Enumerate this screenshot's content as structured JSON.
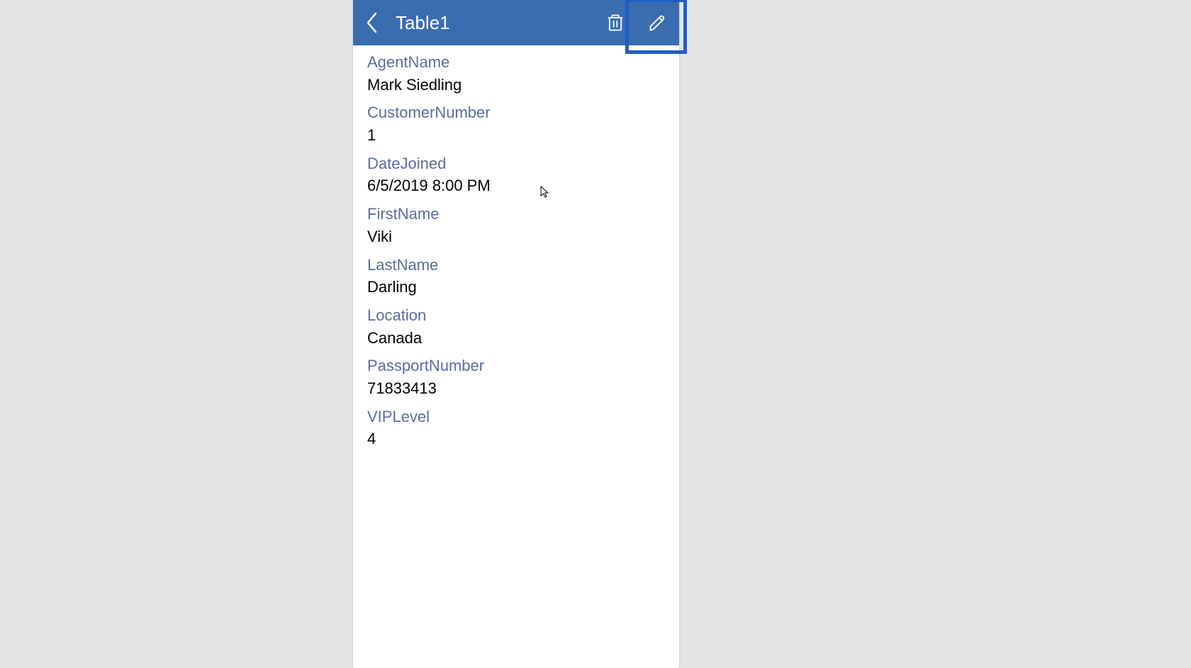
{
  "header": {
    "title": "Table1"
  },
  "fields": [
    {
      "label": "AgentName",
      "value": "Mark Siedling"
    },
    {
      "label": "CustomerNumber",
      "value": "1"
    },
    {
      "label": "DateJoined",
      "value": "6/5/2019 8:00 PM"
    },
    {
      "label": "FirstName",
      "value": "Viki"
    },
    {
      "label": "LastName",
      "value": "Darling"
    },
    {
      "label": "Location",
      "value": "Canada"
    },
    {
      "label": "PassportNumber",
      "value": "71833413"
    },
    {
      "label": "VIPLevel",
      "value": "4"
    }
  ]
}
